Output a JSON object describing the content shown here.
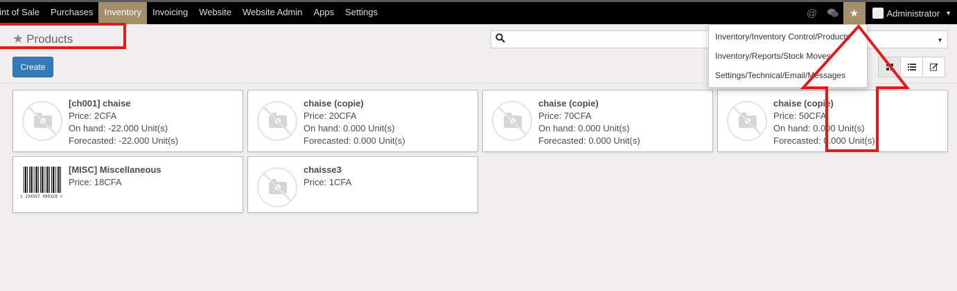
{
  "navbar": {
    "menu": [
      {
        "label": "oint of Sale",
        "active": false
      },
      {
        "label": "Purchases",
        "active": false
      },
      {
        "label": "Inventory",
        "active": true
      },
      {
        "label": "Invoicing",
        "active": false
      },
      {
        "label": "Website",
        "active": false
      },
      {
        "label": "Website Admin",
        "active": false
      },
      {
        "label": "Apps",
        "active": false
      },
      {
        "label": "Settings",
        "active": false
      }
    ],
    "user": "Administrator",
    "icons": [
      "at-icon",
      "chat-icon",
      "star-icon"
    ]
  },
  "page": {
    "title": "Products",
    "create_label": "Create",
    "search_placeholder": ""
  },
  "favorites_menu": {
    "items": [
      "Inventory/Inventory Control/Products",
      "Inventory/Reports/Stock Moves",
      "Settings/Technical/Email/Messages"
    ]
  },
  "products": [
    {
      "name": "[ch001] chaise",
      "price": "Price: 2CFA",
      "on_hand": "On hand: -22.000 Unit(s)",
      "forecasted": "Forecasted: -22.000 Unit(s)",
      "image": "no-image"
    },
    {
      "name": "chaise (copie)",
      "price": "Price: 20CFA",
      "on_hand": "On hand: 0.000 Unit(s)",
      "forecasted": "Forecasted: 0.000 Unit(s)",
      "image": "no-image"
    },
    {
      "name": "chaise (copie)",
      "price": "Price: 70CFA",
      "on_hand": "On hand: 0.000 Unit(s)",
      "forecasted": "Forecasted: 0.000 Unit(s)",
      "image": "no-image"
    },
    {
      "name": "chaise (copie)",
      "price": "Price: 50CFA",
      "on_hand": "On hand: 0.000 Unit(s)",
      "forecasted": "Forecasted: 0.000 Unit(s)",
      "image": "no-image"
    },
    {
      "name": "[MISC] Miscellaneous",
      "price": "Price: 18CFA",
      "image": "barcode",
      "barcode_text": "1 234567 890128 >"
    },
    {
      "name": "chaisse3",
      "price": "Price: 1CFA",
      "image": "no-image"
    }
  ],
  "colors": {
    "navbar_bg": "#000000",
    "active_menu": "#a58f6a",
    "create_button": "#337ab7",
    "annotation_red": "#e11a1a"
  }
}
